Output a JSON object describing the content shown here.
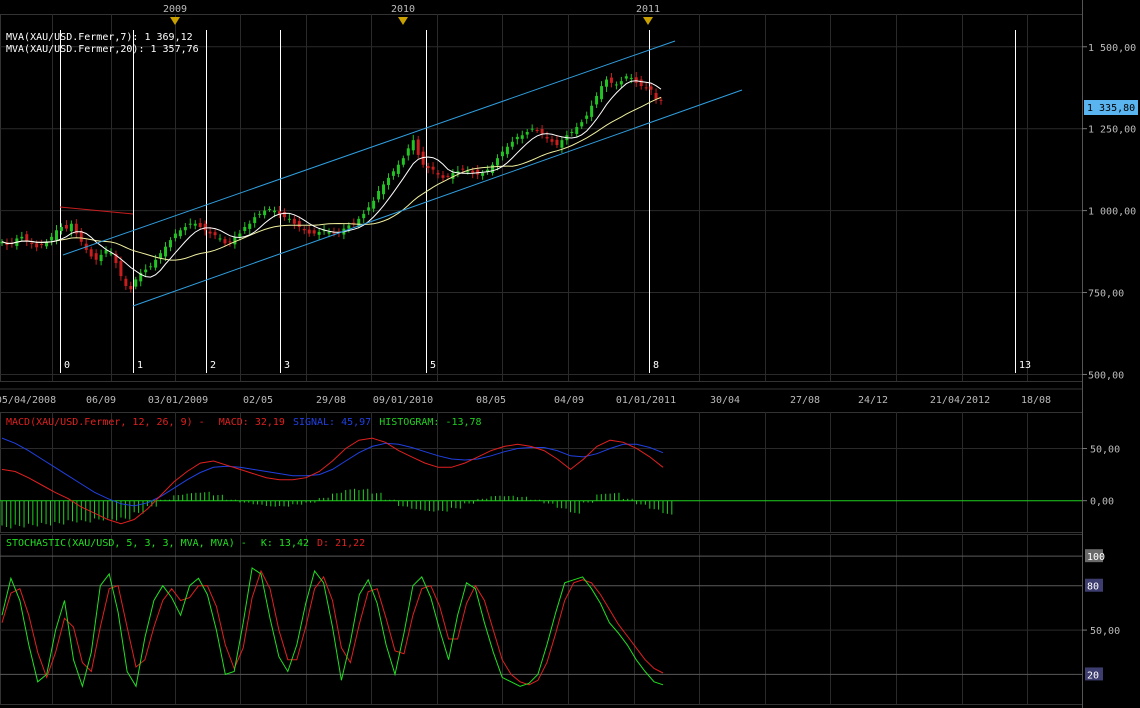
{
  "chart_data": [
    {
      "type": "candlestick",
      "top_years": [
        "2009",
        "2010",
        "2011"
      ],
      "date_labels": [
        "05/04/2008",
        "06/09",
        "03/01/2009",
        "02/05",
        "29/08",
        "09/01/2010",
        "08/05",
        "04/09",
        "01/01/2011",
        "30/04",
        "27/08",
        "24/12",
        "21/04/2012",
        "18/08"
      ],
      "wave_labels": [
        "0",
        "1",
        "2",
        "3",
        "5",
        "8",
        "13"
      ],
      "y_ticks": [
        "1 500,00",
        "1 250,00",
        "1 000,00",
        "750,00",
        "500,00"
      ],
      "ylim": [
        480,
        1600
      ],
      "last_value_label": "1 335,80",
      "legend": [
        "MVA(XAU/USD.Fermer,7): 1 369,12",
        "MVA(XAU/USD.Fermer,20): 1 357,76"
      ],
      "series_close": [
        905,
        895,
        900,
        915,
        920,
        908,
        898,
        888,
        895,
        905,
        920,
        940,
        950,
        945,
        960,
        930,
        905,
        880,
        860,
        850,
        865,
        880,
        870,
        840,
        800,
        770,
        760,
        790,
        810,
        820,
        830,
        850,
        870,
        890,
        910,
        930,
        940,
        950,
        960,
        960,
        950,
        940,
        930,
        925,
        915,
        900,
        905,
        920,
        930,
        950,
        960,
        980,
        990,
        1000,
        1005,
        1000,
        990,
        980,
        975,
        960,
        950,
        940,
        930,
        930,
        935,
        940,
        935,
        930,
        935,
        945,
        955,
        960,
        975,
        990,
        1010,
        1030,
        1060,
        1080,
        1100,
        1120,
        1140,
        1160,
        1190,
        1215,
        1170,
        1140,
        1130,
        1125,
        1110,
        1100,
        1105,
        1115,
        1120,
        1125,
        1120,
        1115,
        1110,
        1115,
        1125,
        1140,
        1160,
        1180,
        1195,
        1210,
        1225,
        1230,
        1240,
        1250,
        1245,
        1235,
        1220,
        1210,
        1200,
        1215,
        1230,
        1240,
        1255,
        1270,
        1290,
        1320,
        1350,
        1380,
        1400,
        1390,
        1385,
        1395,
        1410,
        1405,
        1390,
        1380,
        1375,
        1369,
        1340,
        1335
      ]
    },
    {
      "type": "line",
      "title": "MACD(XAU/USD.Fermer, 12, 26, 9) -",
      "series": [
        {
          "name": "MACD: 32,19",
          "values": [
            30,
            28,
            22,
            15,
            8,
            2,
            -6,
            -12,
            -18,
            -22,
            -18,
            -8,
            5,
            18,
            28,
            36,
            38,
            34,
            30,
            26,
            22,
            20,
            20,
            22,
            28,
            38,
            50,
            58,
            60,
            56,
            48,
            42,
            36,
            32,
            32,
            36,
            42,
            48,
            52,
            54,
            52,
            48,
            40,
            30,
            40,
            52,
            58,
            56,
            50,
            42,
            32
          ]
        },
        {
          "name": "SIGNAL: 45,97",
          "values": [
            60,
            55,
            48,
            40,
            32,
            24,
            16,
            8,
            2,
            -3,
            -5,
            -2,
            4,
            12,
            20,
            27,
            32,
            33,
            32,
            30,
            28,
            26,
            24,
            24,
            25,
            30,
            38,
            46,
            52,
            55,
            54,
            51,
            47,
            43,
            40,
            39,
            40,
            43,
            47,
            50,
            51,
            51,
            48,
            43,
            42,
            45,
            50,
            54,
            54,
            51,
            46
          ]
        },
        {
          "name": "HISTOGRAM: -13,78",
          "values": [
            -28,
            -27,
            -26,
            -25,
            -24,
            -22,
            -22,
            -20,
            -20,
            -19,
            -13,
            -6,
            1,
            6,
            8,
            9,
            6,
            1,
            -2,
            -4,
            -6,
            -6,
            -4,
            -2,
            3,
            8,
            12,
            12,
            8,
            1,
            -6,
            -9,
            -11,
            -11,
            -8,
            -3,
            2,
            5,
            5,
            4,
            1,
            -3,
            -8,
            -13,
            -2,
            7,
            8,
            2,
            -4,
            -9,
            -14
          ]
        }
      ],
      "y_ticks": [
        "50,00",
        "0,00"
      ],
      "ylim": [
        -30,
        85
      ]
    },
    {
      "type": "line",
      "title": "STOCHASTIC(XAU/USD, 5, 3, 3, MVA, MVA) -",
      "series": [
        {
          "name": "K: 13,42",
          "values": [
            60,
            85,
            70,
            40,
            15,
            20,
            50,
            70,
            30,
            12,
            35,
            80,
            88,
            62,
            22,
            12,
            45,
            70,
            80,
            72,
            60,
            80,
            85,
            74,
            50,
            20,
            22,
            55,
            92,
            88,
            58,
            32,
            22,
            40,
            68,
            90,
            82,
            52,
            16,
            42,
            74,
            84,
            68,
            40,
            20,
            48,
            80,
            86,
            72,
            50,
            30,
            60,
            82,
            78,
            55,
            35,
            18,
            15,
            12,
            14,
            20,
            40,
            62,
            82,
            84,
            86,
            78,
            68,
            55,
            48,
            40,
            30,
            22,
            15,
            13
          ]
        },
        {
          "name": "D: 21,22",
          "values": [
            55,
            75,
            78,
            60,
            35,
            18,
            35,
            58,
            52,
            28,
            22,
            52,
            78,
            80,
            52,
            25,
            30,
            52,
            70,
            78,
            70,
            72,
            80,
            80,
            66,
            40,
            24,
            38,
            72,
            90,
            78,
            50,
            30,
            30,
            52,
            78,
            86,
            70,
            38,
            28,
            54,
            76,
            78,
            58,
            36,
            34,
            60,
            78,
            80,
            66,
            44,
            44,
            68,
            80,
            70,
            50,
            30,
            20,
            15,
            13,
            16,
            28,
            48,
            70,
            82,
            84,
            82,
            74,
            64,
            54,
            46,
            38,
            30,
            24,
            21
          ]
        }
      ],
      "y_ticks": [
        "100",
        "80",
        "50,00",
        "20"
      ],
      "ylim": [
        0,
        115
      ]
    }
  ],
  "colors": {
    "up": "#22c322",
    "down": "#c81e1e",
    "mva7": "#ffffff",
    "mva20": "#f0f0a0",
    "channel": "#2f9fe0",
    "macd_red": "#e02020",
    "signal_blue": "#2040e0",
    "hist_green": "#20d020",
    "stoch_k": "#20e020",
    "stoch_d": "#e02020",
    "baseline": "#20d020",
    "last_badge_bg": "#5ab4f0"
  }
}
